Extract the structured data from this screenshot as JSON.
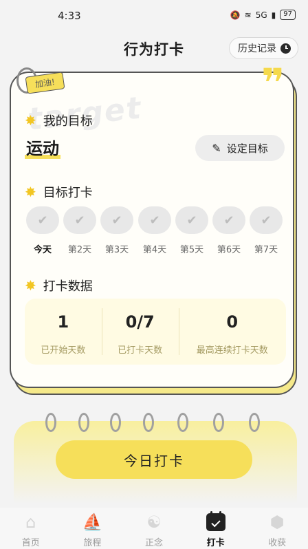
{
  "status_bar": {
    "time": "4:33",
    "battery": "97",
    "network": "5G"
  },
  "header": {
    "title": "行为打卡",
    "history_label": "历史记录"
  },
  "card": {
    "tag": "加油!",
    "watermark": "target",
    "goal_section_title": "我的目标",
    "goal_value": "运动",
    "set_goal_label": "设定目标",
    "checkin_section_title": "目标打卡",
    "days": [
      {
        "label": "今天",
        "checked": false
      },
      {
        "label": "第2天",
        "checked": false
      },
      {
        "label": "第3天",
        "checked": false
      },
      {
        "label": "第4天",
        "checked": false
      },
      {
        "label": "第5天",
        "checked": false
      },
      {
        "label": "第6天",
        "checked": false
      },
      {
        "label": "第7天",
        "checked": false
      }
    ],
    "stats_section_title": "打卡数据",
    "stats": [
      {
        "value": "1",
        "label": "已开始天数"
      },
      {
        "value": "0/7",
        "label": "已打卡天数"
      },
      {
        "value": "0",
        "label": "最高连续打卡天数"
      }
    ]
  },
  "checkin_button": "今日打卡",
  "nav": [
    {
      "label": "首页",
      "icon": "home-icon",
      "active": false
    },
    {
      "label": "旅程",
      "icon": "sailboat-icon",
      "active": false
    },
    {
      "label": "正念",
      "icon": "meditation-icon",
      "active": false
    },
    {
      "label": "打卡",
      "icon": "calendar-check-icon",
      "active": true
    },
    {
      "label": "收获",
      "icon": "badge-icon",
      "active": false
    }
  ],
  "colors": {
    "accent": "#f6df5a",
    "background": "#f3f3f3",
    "card": "#fffef9"
  }
}
